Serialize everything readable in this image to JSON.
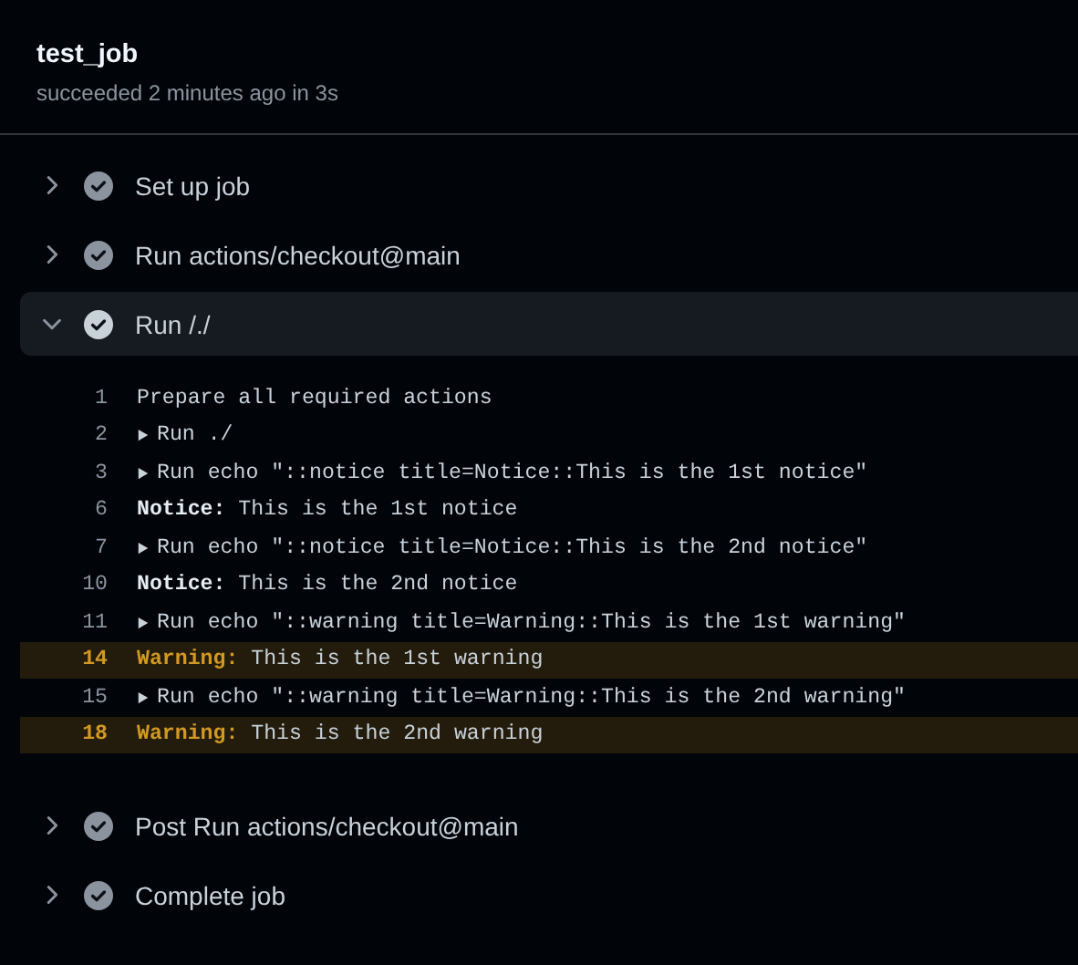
{
  "job": {
    "title": "test_job",
    "subtitle": "succeeded 2 minutes ago in 3s"
  },
  "steps": [
    {
      "name": "Set up job",
      "expanded": false
    },
    {
      "name": "Run actions/checkout@main",
      "expanded": false
    },
    {
      "name": "Run /./",
      "expanded": true,
      "log": [
        {
          "number": "1",
          "kind": "plain",
          "text": "Prepare all required actions"
        },
        {
          "number": "2",
          "kind": "group",
          "text": "Run ./"
        },
        {
          "number": "3",
          "kind": "group",
          "text": "Run echo \"::notice title=Notice::This is the 1st notice\""
        },
        {
          "number": "6",
          "kind": "notice",
          "label": "Notice:",
          "text": "This is the 1st notice"
        },
        {
          "number": "7",
          "kind": "group",
          "text": "Run echo \"::notice title=Notice::This is the 2nd notice\""
        },
        {
          "number": "10",
          "kind": "notice",
          "label": "Notice:",
          "text": "This is the 2nd notice"
        },
        {
          "number": "11",
          "kind": "group",
          "text": "Run echo \"::warning title=Warning::This is the 1st warning\""
        },
        {
          "number": "14",
          "kind": "warning",
          "label": "Warning:",
          "text": "This is the 1st warning"
        },
        {
          "number": "15",
          "kind": "group",
          "text": "Run echo \"::warning title=Warning::This is the 2nd warning\""
        },
        {
          "number": "18",
          "kind": "warning",
          "label": "Warning:",
          "text": "This is the 2nd warning"
        }
      ]
    },
    {
      "name": "Post Run actions/checkout@main",
      "expanded": false
    },
    {
      "name": "Complete job",
      "expanded": false
    }
  ]
}
